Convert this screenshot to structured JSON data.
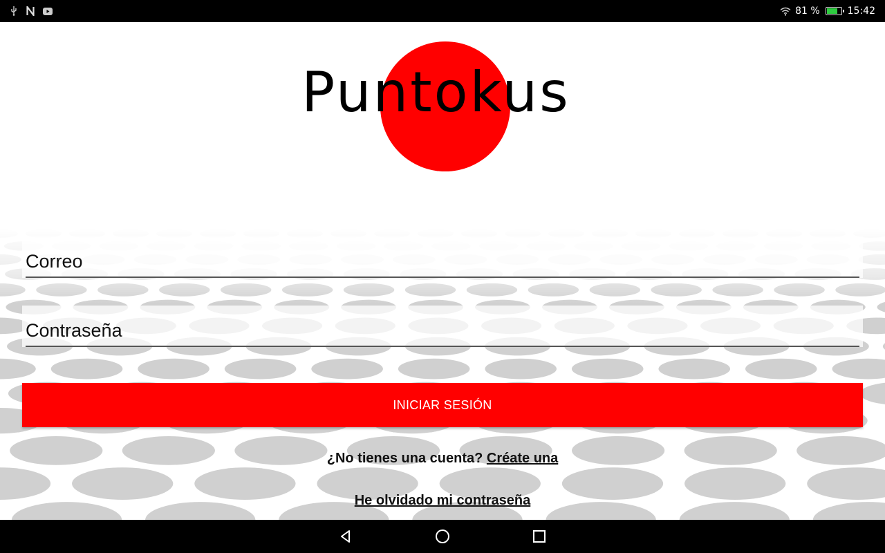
{
  "status_bar": {
    "left_icons": [
      "usb-icon",
      "n-notification-icon",
      "youtube-icon"
    ],
    "wifi_icon": "wifi-icon",
    "battery_percent": "81 %",
    "battery_level": 0.81,
    "time": "15:42"
  },
  "logo": {
    "text": "Puntokus",
    "circle_color": "#ff0000"
  },
  "form": {
    "email_placeholder": "Correo",
    "password_placeholder": "Contraseña",
    "email_value": "",
    "password_value": ""
  },
  "login_button": {
    "label": "INICIAR SESIÓN",
    "color": "#ff0000"
  },
  "register": {
    "prompt": "¿No tienes una cuenta? ",
    "link": "Créate una"
  },
  "forgot_password": {
    "link": "He olvidado mi contraseña"
  },
  "nav_bar": {
    "icons": [
      "back-triangle-icon",
      "home-circle-icon",
      "recents-square-icon"
    ]
  }
}
